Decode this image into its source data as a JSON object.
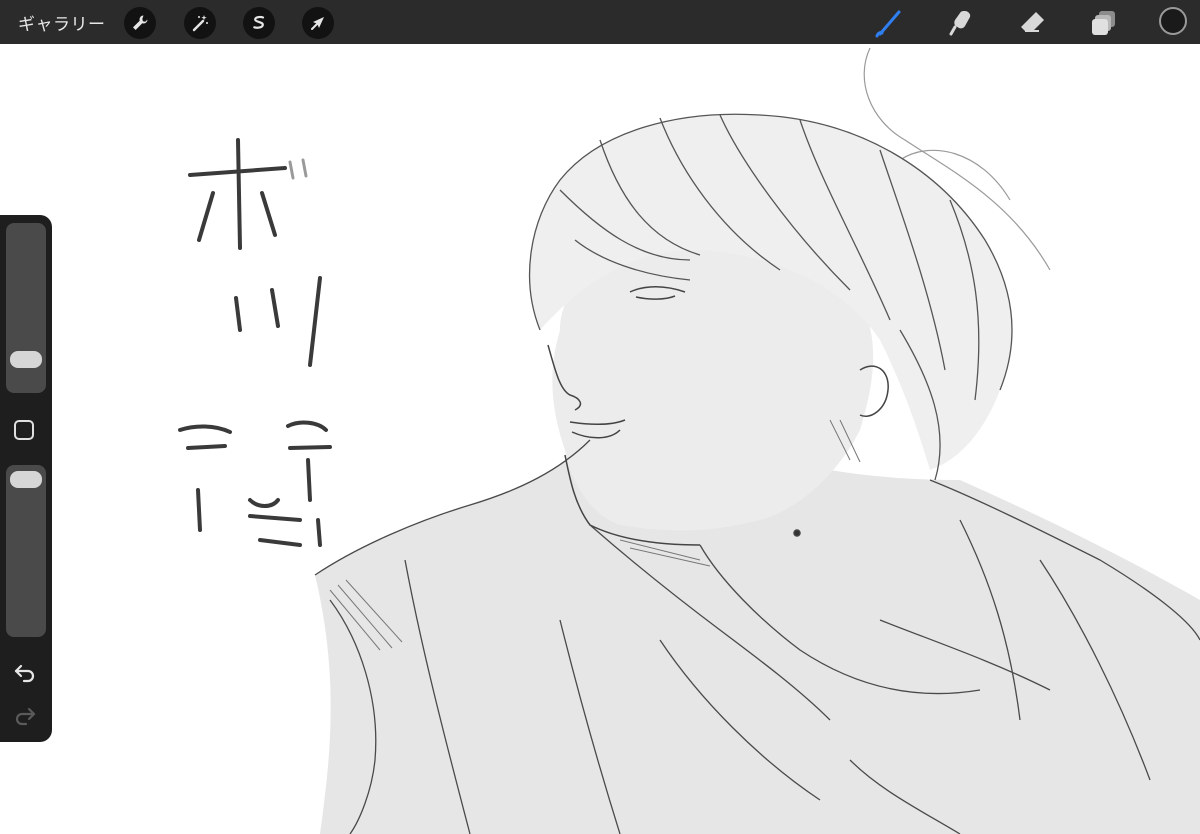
{
  "toolbar": {
    "gallery_label": "ギャラリー",
    "left_tools": [
      {
        "icon": "wrench-icon",
        "name": "actions"
      },
      {
        "icon": "magic-wand-icon",
        "name": "adjustments"
      },
      {
        "icon": "selection-icon",
        "name": "selection"
      },
      {
        "icon": "arrow-cursor-icon",
        "name": "transform"
      }
    ],
    "right_tools": [
      {
        "icon": "brush-icon",
        "name": "brush",
        "active": true
      },
      {
        "icon": "smudge-icon",
        "name": "smudge",
        "active": false
      },
      {
        "icon": "eraser-icon",
        "name": "eraser",
        "active": false
      },
      {
        "icon": "layers-icon",
        "name": "layers",
        "active": false
      }
    ],
    "active_color": "#1a1a1a",
    "accent_color": "#2f7ff0"
  },
  "sidebar": {
    "brush_size_level": 0.25,
    "opacity_level": 0.95,
    "undo_icon": "undo-icon",
    "redo_icon": "redo-icon",
    "redo_enabled": false
  },
  "canvas": {
    "background": "#ffffff"
  }
}
